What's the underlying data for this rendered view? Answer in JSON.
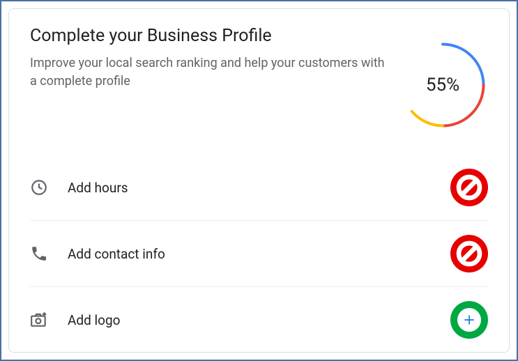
{
  "header": {
    "title": "Complete your Business Profile",
    "subtitle": "Improve your local search ranking and help your customers with a complete profile"
  },
  "progress": {
    "label": "55%"
  },
  "items": [
    {
      "label": "Add hours",
      "status": "blocked"
    },
    {
      "label": "Add contact info",
      "status": "blocked"
    },
    {
      "label": "Add logo",
      "status": "allowed"
    }
  ],
  "colors": {
    "brand_blue": "#4285F4",
    "brand_red": "#EA4335",
    "brand_yellow": "#FBBC04",
    "brand_green": "#34A853",
    "overlay_red": "#e60000",
    "overlay_green": "#00a843"
  }
}
